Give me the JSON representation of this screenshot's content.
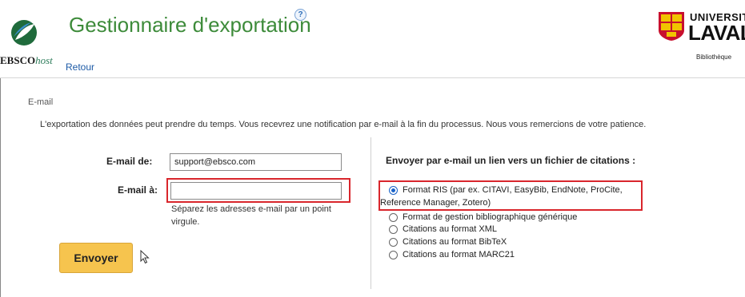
{
  "header": {
    "brand_name": "EBSCO",
    "brand_suffix": "host",
    "title": "Gestionnaire d'exportation",
    "help_symbol": "?",
    "back_link": "Retour",
    "institution_top": "UNIVERSITÉ",
    "institution_name": "LAVAL",
    "institution_unit": "Bibliothèque"
  },
  "section": {
    "label": "E-mail",
    "notice": "L'exportation des données peut prendre du temps. Vous recevrez une notification par e-mail à la fin du processus. Nous vous remercions de votre patience."
  },
  "form": {
    "from_label": "E-mail de:",
    "from_value": "support@ebsco.com",
    "to_label": "E-mail à:",
    "to_value": "",
    "hint": "Séparez les adresses e-mail par un point virgule.",
    "send_label": "Envoyer"
  },
  "formats": {
    "title": "Envoyer par e-mail un lien vers un fichier de citations :",
    "options": [
      {
        "label_line1": "Format RIS (par ex. CITAVI, EasyBib, EndNote, ProCite,",
        "label_line2": "Reference Manager, Zotero)",
        "selected": true
      },
      {
        "label": "Format de gestion bibliographique générique",
        "selected": false
      },
      {
        "label": "Citations au format XML",
        "selected": false
      },
      {
        "label": "Citations au format BibTeX",
        "selected": false
      },
      {
        "label": "Citations au format MARC21",
        "selected": false
      }
    ]
  },
  "colors": {
    "title_green": "#3d8b3a",
    "link_blue": "#1c5aa6",
    "highlight_red": "#d9262c",
    "button_yellow": "#f6c44e",
    "laval_red": "#c8102e",
    "laval_gold": "#f1c400"
  },
  "icons": {
    "brand_logo": "ebsco-leaf-logo-icon",
    "institution_logo": "laval-shield-icon",
    "help": "help-circle-icon",
    "pointer": "mouse-pointer-icon"
  }
}
